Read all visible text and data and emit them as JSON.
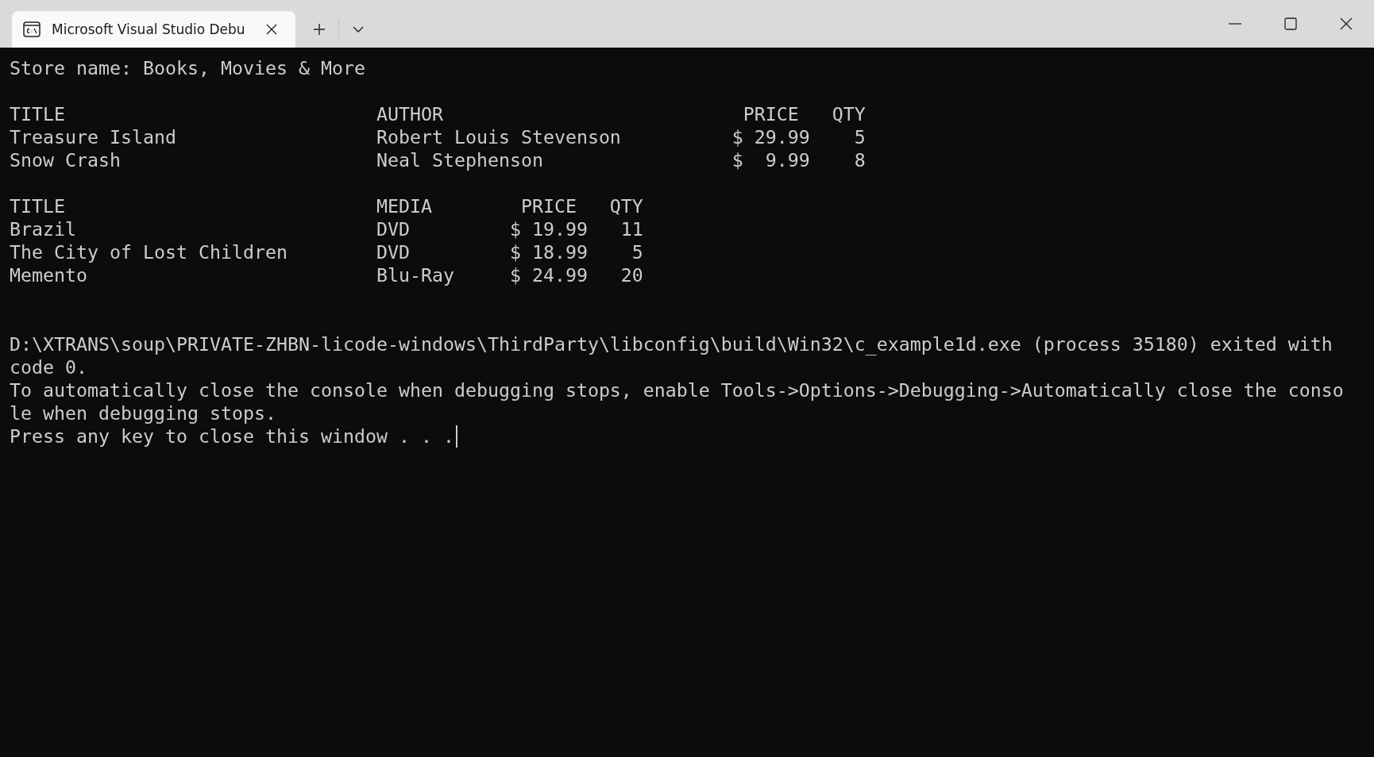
{
  "window": {
    "tab": {
      "title": "Microsoft Visual Studio Debu",
      "selected": true
    }
  },
  "console": {
    "blocks": [
      {
        "kind": "text",
        "lines": [
          "Store name: Books, Movies & More"
        ]
      },
      {
        "kind": "text",
        "lines": [
          "TITLE                            AUTHOR                           PRICE   QTY",
          "Treasure Island                  Robert Louis Stevenson          $ 29.99    5",
          "Snow Crash                       Neal Stephenson                 $  9.99    8"
        ]
      },
      {
        "kind": "text",
        "lines": [
          "TITLE                            MEDIA        PRICE   QTY",
          "Brazil                           DVD         $ 19.99   11",
          "The City of Lost Children        DVD         $ 18.99    5",
          "Memento                          Blu-Ray     $ 24.99   20"
        ]
      },
      {
        "kind": "footer",
        "lines": [
          "D:\\XTRANS\\soup\\PRIVATE-ZHBN-licode-windows\\ThirdParty\\libconfig\\build\\Win32\\c_example1d.exe (process 35180) exited with",
          "code 0.",
          "To automatically close the console when debugging stops, enable Tools->Options->Debugging->Automatically close the conso",
          "le when debugging stops."
        ]
      },
      {
        "kind": "prompt",
        "lines": [
          "Press any key to close this window . . ."
        ]
      }
    ]
  }
}
